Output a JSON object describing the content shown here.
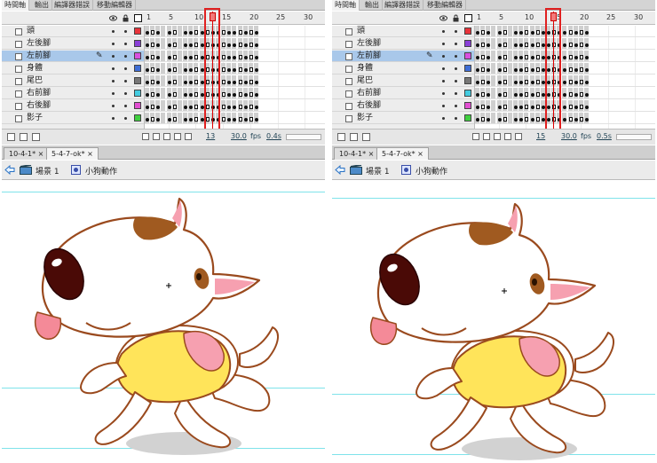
{
  "panels": [
    {
      "id": "left",
      "tabs": [
        "時間軸",
        "輸出",
        "編譯器錯誤",
        "移動編輯器"
      ],
      "ruler_labels": [
        "1",
        "5",
        "10",
        "15",
        "20",
        "25",
        "30"
      ],
      "layers": [
        "頭",
        "左後腳",
        "左前腳",
        "身體",
        "尾巴",
        "右前腳",
        "右後腳",
        "影子"
      ],
      "layer_colors": [
        "#e8333a",
        "#8a3fd6",
        "#d94fe0",
        "#3f6ed6",
        "#777777",
        "#43cbe0",
        "#e24fd2",
        "#3fcf3f"
      ],
      "selected_layer": 2,
      "current_frame": 13,
      "status": {
        "frame": "13",
        "fps": "30.0",
        "fps_unit": "fps",
        "time": "0.4s"
      },
      "doc_tabs": [
        "10-4-1*",
        "5-4-7-ok*"
      ],
      "breadcrumb": [
        "場景 1",
        "小狗動作"
      ]
    },
    {
      "id": "right",
      "tabs": [
        "時間軸",
        "輸出",
        "編譯器錯誤",
        "移動編輯器"
      ],
      "ruler_labels": [
        "1",
        "5",
        "10",
        "15",
        "20",
        "25",
        "30"
      ],
      "layers": [
        "頭",
        "左後腳",
        "左前腳",
        "身體",
        "尾巴",
        "右前腳",
        "右後腳",
        "影子"
      ],
      "layer_colors": [
        "#e8333a",
        "#8a3fd6",
        "#d94fe0",
        "#3f6ed6",
        "#777777",
        "#43cbe0",
        "#e24fd2",
        "#3fcf3f"
      ],
      "selected_layer": 2,
      "current_frame": 15,
      "status": {
        "frame": "15",
        "fps": "30.0",
        "fps_unit": "fps",
        "time": "0.5s"
      },
      "doc_tabs": [
        "10-4-1*",
        "5-4-7-ok*"
      ],
      "breadcrumb": [
        "場景 1",
        "小狗動作"
      ]
    }
  ],
  "colors": {
    "selected_layer": "#a9c8ea",
    "playhead": "#dd0000",
    "highlight_box": "#e02020",
    "guide_lines": "#7fe3ea",
    "dog_outline": "#9a4a1e",
    "sweater": "#ffe45a",
    "ear_pink": "#f6a0b0"
  }
}
